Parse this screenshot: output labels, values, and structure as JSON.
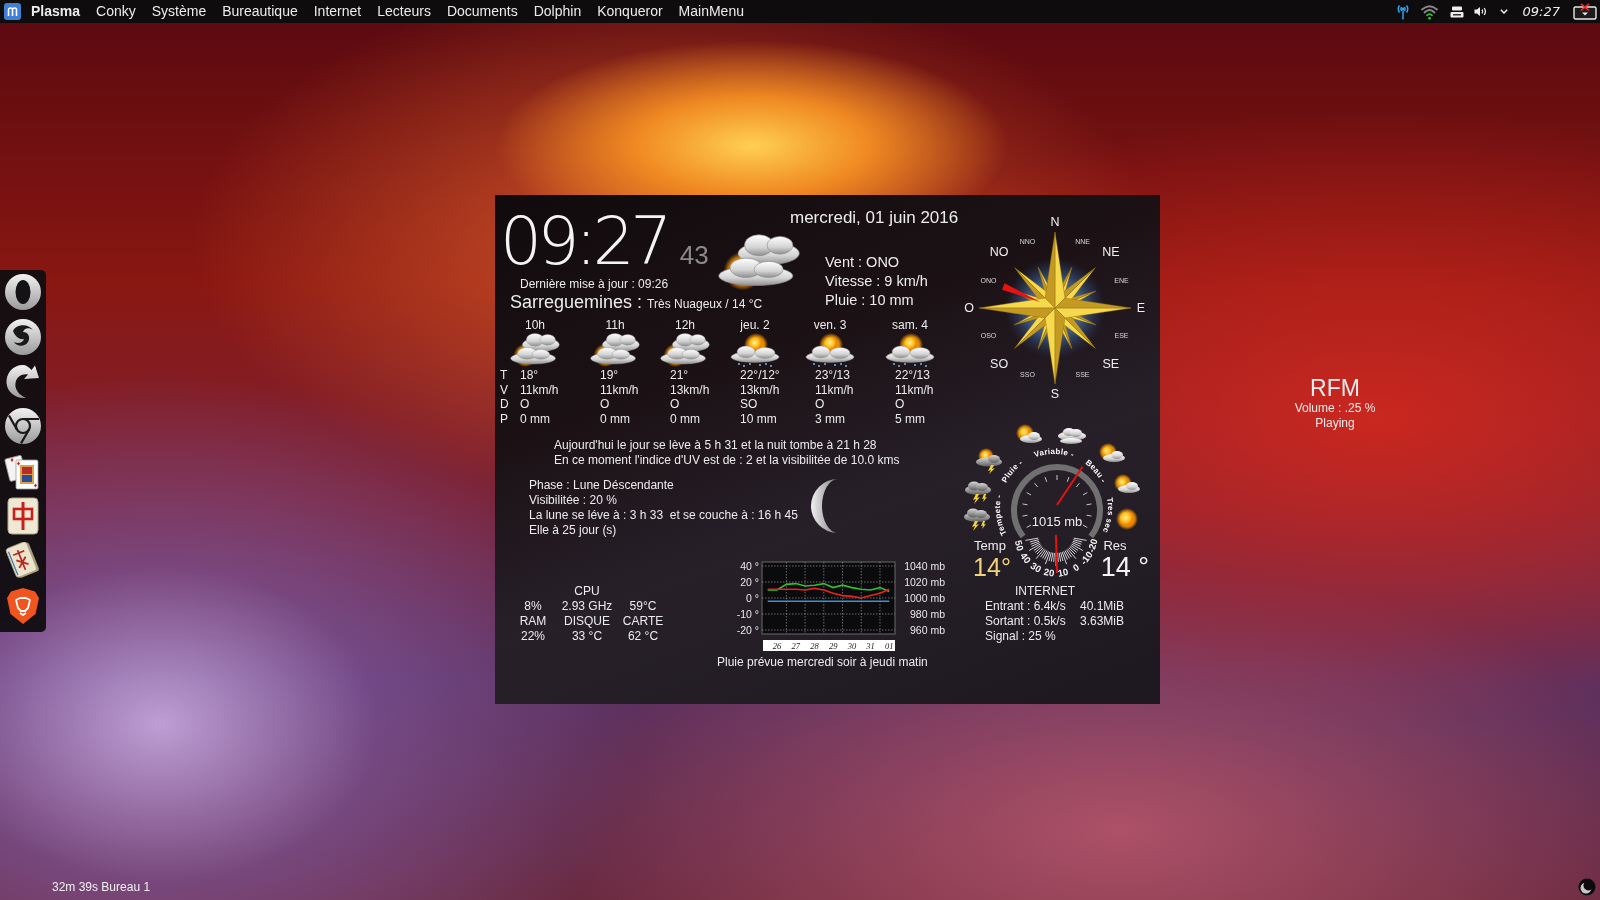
{
  "top_bar": {
    "menu": [
      {
        "label": "Plasma",
        "kind": "app"
      },
      {
        "label": "Conky",
        "kind": "menu"
      },
      {
        "label": "Système",
        "kind": "menu"
      },
      {
        "label": "Bureautique",
        "kind": "menu"
      },
      {
        "label": "Internet",
        "kind": "menu"
      },
      {
        "label": "Lecteurs",
        "kind": "menu"
      },
      {
        "label": "Documents",
        "kind": "menu"
      },
      {
        "label": "Dolphin",
        "kind": "menu"
      },
      {
        "label": "Konqueror",
        "kind": "menu"
      },
      {
        "label": "MainMenu",
        "kind": "menu"
      }
    ],
    "clock": "09:27"
  },
  "conky": {
    "time": "09:27",
    "seconds": "43",
    "date": "mercredi, 01 juin 2016",
    "last_update": "Dernière mise à jour : 09:26",
    "city": "Sarreguemines :",
    "condition": "Très Nuageux / 14 °C",
    "wind": [
      "Vent : ONO",
      "Vitesse : 9 km/h",
      "Pluie : 10 mm"
    ],
    "forecast": {
      "row_labels": [
        "T",
        "V",
        "D",
        "P"
      ],
      "columns": [
        {
          "label": "10h",
          "kind": "cloudy",
          "values": [
            "18°",
            "11km/h",
            "O",
            "0 mm"
          ]
        },
        {
          "label": "11h",
          "kind": "cloudy",
          "values": [
            "19°",
            "11km/h",
            "O",
            "0 mm"
          ]
        },
        {
          "label": "12h",
          "kind": "cloudy",
          "values": [
            "21°",
            "13km/h",
            "O",
            "0 mm"
          ]
        },
        {
          "label": "jeu. 2",
          "kind": "showers",
          "values": [
            "22°/12°",
            "13km/h",
            "SO",
            "10 mm"
          ]
        },
        {
          "label": "ven. 3",
          "kind": "showers",
          "values": [
            "23°/13",
            "11km/h",
            "O",
            "3 mm"
          ]
        },
        {
          "label": "sam. 4",
          "kind": "showers",
          "values": [
            "22°/13",
            "11km/h",
            "O",
            "5 mm"
          ]
        }
      ]
    },
    "sun_info": [
      "Aujourd'hui le jour se lève à 5 h 31 et la nuit tombe à 21 h 28",
      "En ce moment l'indice d'UV est de : 2 et la visibilitée de 10.0 kms"
    ],
    "moon": [
      "Phase : Lune Déscendante",
      "Visibilitée : 20 %",
      "La lune se léve à : 3 h 33  et se couche à : 16 h 45",
      "Elle à 25 jour (s)"
    ],
    "system": {
      "heading": "CPU",
      "rows": [
        [
          "8%",
          "2.93 GHz",
          "59°C"
        ],
        [
          "RAM",
          "DISQUE",
          "CARTE"
        ],
        [
          "22%",
          "33 °C",
          "62 °C"
        ]
      ]
    },
    "chart": {
      "left_labels": [
        "40 °",
        "20 °",
        "0 °",
        "-10 °",
        "-20 °"
      ],
      "chart_data": {
        "type": "line",
        "grid": true,
        "categories": [
          null,
          "26",
          null,
          "27",
          null,
          "28",
          null,
          "29",
          null,
          "30",
          null,
          "31",
          null,
          "01"
        ],
        "ylim": [
          960,
          1040
        ],
        "yticks": [
          {
            "value": 1040,
            "label": "1040 mb"
          },
          {
            "value": 1020,
            "label": "1020 mb"
          },
          {
            "value": 1000,
            "label": "1000 mb"
          },
          {
            "value": 980,
            "label": "980 mb"
          },
          {
            "value": 960,
            "label": "960 mb"
          }
        ],
        "series": [
          {
            "color": "#2fbf2f",
            "values": [
              1010,
              1010,
              1017,
              1018,
              1015,
              1016,
              1018,
              1013,
              1016,
              1013,
              1011,
              1010,
              1013,
              1008
            ]
          },
          {
            "color": "#e8231e",
            "values": [
              1011,
              1011,
              1011,
              1011,
              1010,
              1012,
              1010,
              1006,
              1003,
              1002,
              1000,
              1003,
              1006,
              1011
            ]
          },
          {
            "color": "#3d8fd6",
            "values": [
              996,
              996,
              996,
              996,
              996,
              996,
              996,
              996,
              996,
              996,
              996,
              996,
              996,
              996
            ]
          }
        ]
      },
      "caption": "Pluie prévue mercredi soir à jeudi matin"
    },
    "compass": {
      "points": [
        {
          "label": "N",
          "needle": false
        },
        {
          "label": "NNE",
          "needle": false
        },
        {
          "label": "NE",
          "needle": false
        },
        {
          "label": "ENE",
          "needle": false
        },
        {
          "label": "E",
          "needle": false
        },
        {
          "label": "ESE",
          "needle": false
        },
        {
          "label": "SE",
          "needle": false
        },
        {
          "label": "SSE",
          "needle": false
        },
        {
          "label": "S",
          "needle": false
        },
        {
          "label": "SSO",
          "needle": false
        },
        {
          "label": "SO",
          "needle": false
        },
        {
          "label": "OSO",
          "needle": false
        },
        {
          "label": "O",
          "needle": false
        },
        {
          "label": "ONO",
          "needle": true
        },
        {
          "label": "NO",
          "needle": false
        },
        {
          "label": "NNO",
          "needle": false
        }
      ]
    },
    "barometer": {
      "scale": [
        "Tempete -",
        "Pluie -",
        "Variable -",
        "Beau -",
        "Tres sec"
      ],
      "reading": "1015 mb",
      "level": 0.63,
      "thermometer": {
        "scale": [
          "50",
          "40",
          "30",
          "20",
          "10",
          "0",
          "-10",
          "-20"
        ],
        "level": 0.51
      },
      "temp_label": "Temp",
      "temp_value": "14°",
      "res_label": "Res",
      "res_value": "14 °"
    },
    "internet": {
      "title": "INTERNET",
      "rows": [
        [
          "Entrant : 6.4k/s",
          "40.1MiB"
        ],
        [
          "Sortant : 0.5k/s",
          "3.63MiB"
        ]
      ],
      "signal": "Signal : 25 %"
    }
  },
  "radio": {
    "station": "RFM",
    "volume": "Volume : .25 %",
    "status": "Playing"
  },
  "status_text": "32m 39s Bureau 1"
}
